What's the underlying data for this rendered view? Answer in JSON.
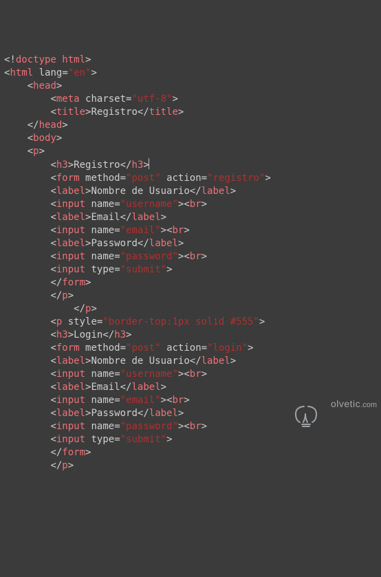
{
  "code": {
    "doctype": "doctype html",
    "html_tag": "html",
    "lang_attr": "lang",
    "lang_val": "\"en\"",
    "head_tag": "head",
    "meta_tag": "meta",
    "charset_attr": "charset",
    "charset_val": "\"utf-8\"",
    "title_tag": "title",
    "title_text": "Registro",
    "body_tag": "body",
    "p_tag": "p",
    "h3_tag": "h3",
    "h3_registro": "Registro",
    "h3_login": "Login",
    "form_tag": "form",
    "method_attr": "method",
    "method_val": "\"post\"",
    "action_attr": "action",
    "action_registro": "\"registro\"",
    "action_login": "\"login\"",
    "label_tag": "label",
    "label_user": "Nombre de Usuario",
    "label_email": "Email",
    "label_pass": "Password",
    "input_tag": "input",
    "name_attr": "name",
    "name_user": "\"username\"",
    "name_email": "\"email\"",
    "name_pass": "\"password\"",
    "type_attr": "type",
    "type_submit": "\"submit\"",
    "br_tag": "br",
    "style_attr": "style",
    "style_val": "\"border-top:1px solid #555\""
  },
  "watermark": {
    "text": "olvetic",
    "suffix": ".com"
  }
}
